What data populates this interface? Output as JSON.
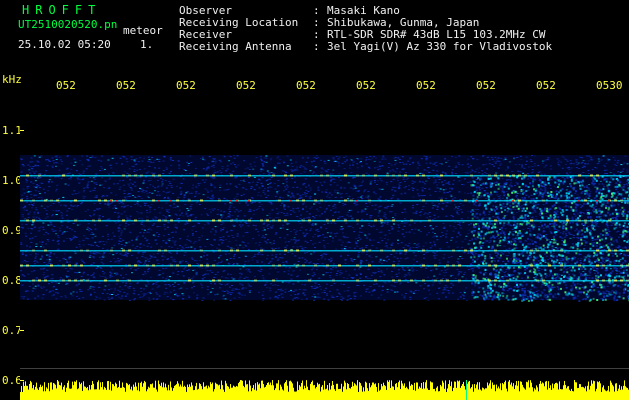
{
  "header": {
    "brand": "HROFFT",
    "file_name": "UT2510020520.pn",
    "file_tag": "meteor",
    "datetime": "25.10.02 05:20",
    "frame_no": "1."
  },
  "meta": [
    {
      "label": "Observer",
      "value": "Masaki Kano"
    },
    {
      "label": "Receiving Location",
      "value": "Shibukawa, Gunma, Japan"
    },
    {
      "label": "Receiver",
      "value": "RTL-SDR SDR# 43dB L15 103.2MHz CW"
    },
    {
      "label": "Receiving Antenna",
      "value": "3el Yagi(V) Az 330 for Vladivostok"
    }
  ],
  "meta_colon": ":",
  "axis": {
    "unit": "kHz",
    "y_ticks": [
      "1.1",
      "1.0",
      "0.9",
      "0.8",
      "0.7",
      "0.6"
    ],
    "x_ticks": [
      "052",
      "052",
      "052",
      "052",
      "052",
      "052",
      "052",
      "052",
      "052",
      "0530"
    ]
  },
  "chart_data": {
    "type": "heatmap",
    "y_unit": "kHz",
    "y_ticks": [
      1.1,
      1.0,
      0.9,
      0.8,
      0.7,
      0.6
    ],
    "x_ticks": [
      "052",
      "052",
      "052",
      "052",
      "052",
      "052",
      "052",
      "052",
      "052",
      "0530"
    ],
    "band_kHz": [
      0.76,
      1.05
    ],
    "strong_lines_kHz": [
      1.01,
      0.96,
      0.92,
      0.86,
      0.83,
      0.8
    ],
    "colors": {
      "background": "#000000",
      "noise": "#1030c0",
      "signal": "#00e0ff",
      "strong": "#ffff40",
      "peak": "#ff2020",
      "baseline": "#ffff00"
    }
  }
}
